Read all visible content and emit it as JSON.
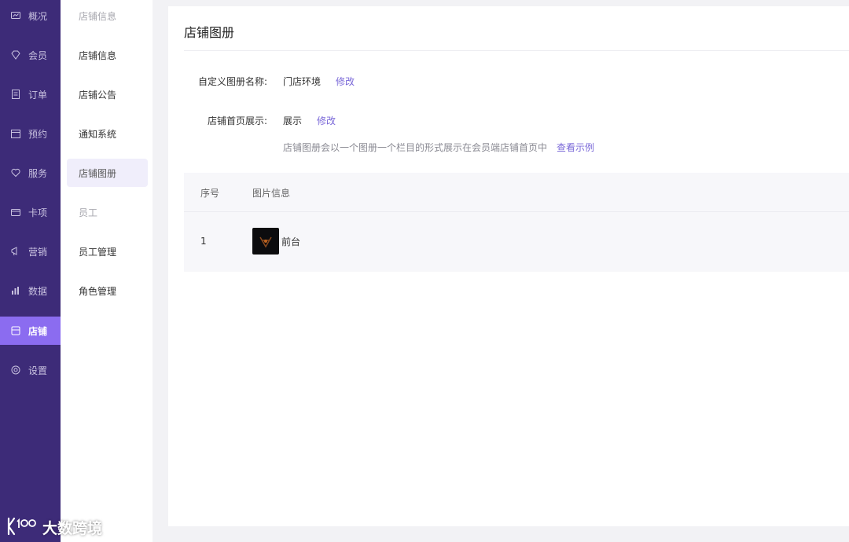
{
  "sidebar": {
    "items": [
      {
        "label": "概况",
        "icon": "dashboard-icon"
      },
      {
        "label": "会员",
        "icon": "member-icon"
      },
      {
        "label": "订单",
        "icon": "order-icon"
      },
      {
        "label": "预约",
        "icon": "booking-icon"
      },
      {
        "label": "服务",
        "icon": "service-icon"
      },
      {
        "label": "卡项",
        "icon": "card-icon"
      },
      {
        "label": "营销",
        "icon": "marketing-icon"
      },
      {
        "label": "数据",
        "icon": "data-icon"
      },
      {
        "label": "店铺",
        "icon": "store-icon",
        "active": true
      },
      {
        "label": "设置",
        "icon": "settings-icon"
      }
    ]
  },
  "subnav": {
    "items": [
      {
        "label": "店铺信息",
        "type": "header"
      },
      {
        "label": "店铺信息"
      },
      {
        "label": "店铺公告"
      },
      {
        "label": "通知系统"
      },
      {
        "label": "店铺图册",
        "active": true
      },
      {
        "label": "员工",
        "type": "header"
      },
      {
        "label": "员工管理"
      },
      {
        "label": "角色管理"
      }
    ]
  },
  "main": {
    "title": "店铺图册",
    "album_name": {
      "label": "自定义图册名称:",
      "value": "门店环境",
      "edit": "修改"
    },
    "home_display": {
      "label": "店铺首页展示:",
      "value": "展示",
      "edit": "修改"
    },
    "hint": "店铺图册会以一个图册一个栏目的形式展示在会员端店铺首页中",
    "view_example": "查看示例",
    "table": {
      "headers": [
        "序号",
        "图片信息"
      ],
      "rows": [
        {
          "index": "1",
          "name": "前台"
        }
      ]
    }
  },
  "watermark": {
    "text": "大数跨境",
    "logo": "k100"
  },
  "colors": {
    "sidebar": "#3d2b78",
    "accent": "#8b6cf0",
    "link": "#7a68d8"
  }
}
